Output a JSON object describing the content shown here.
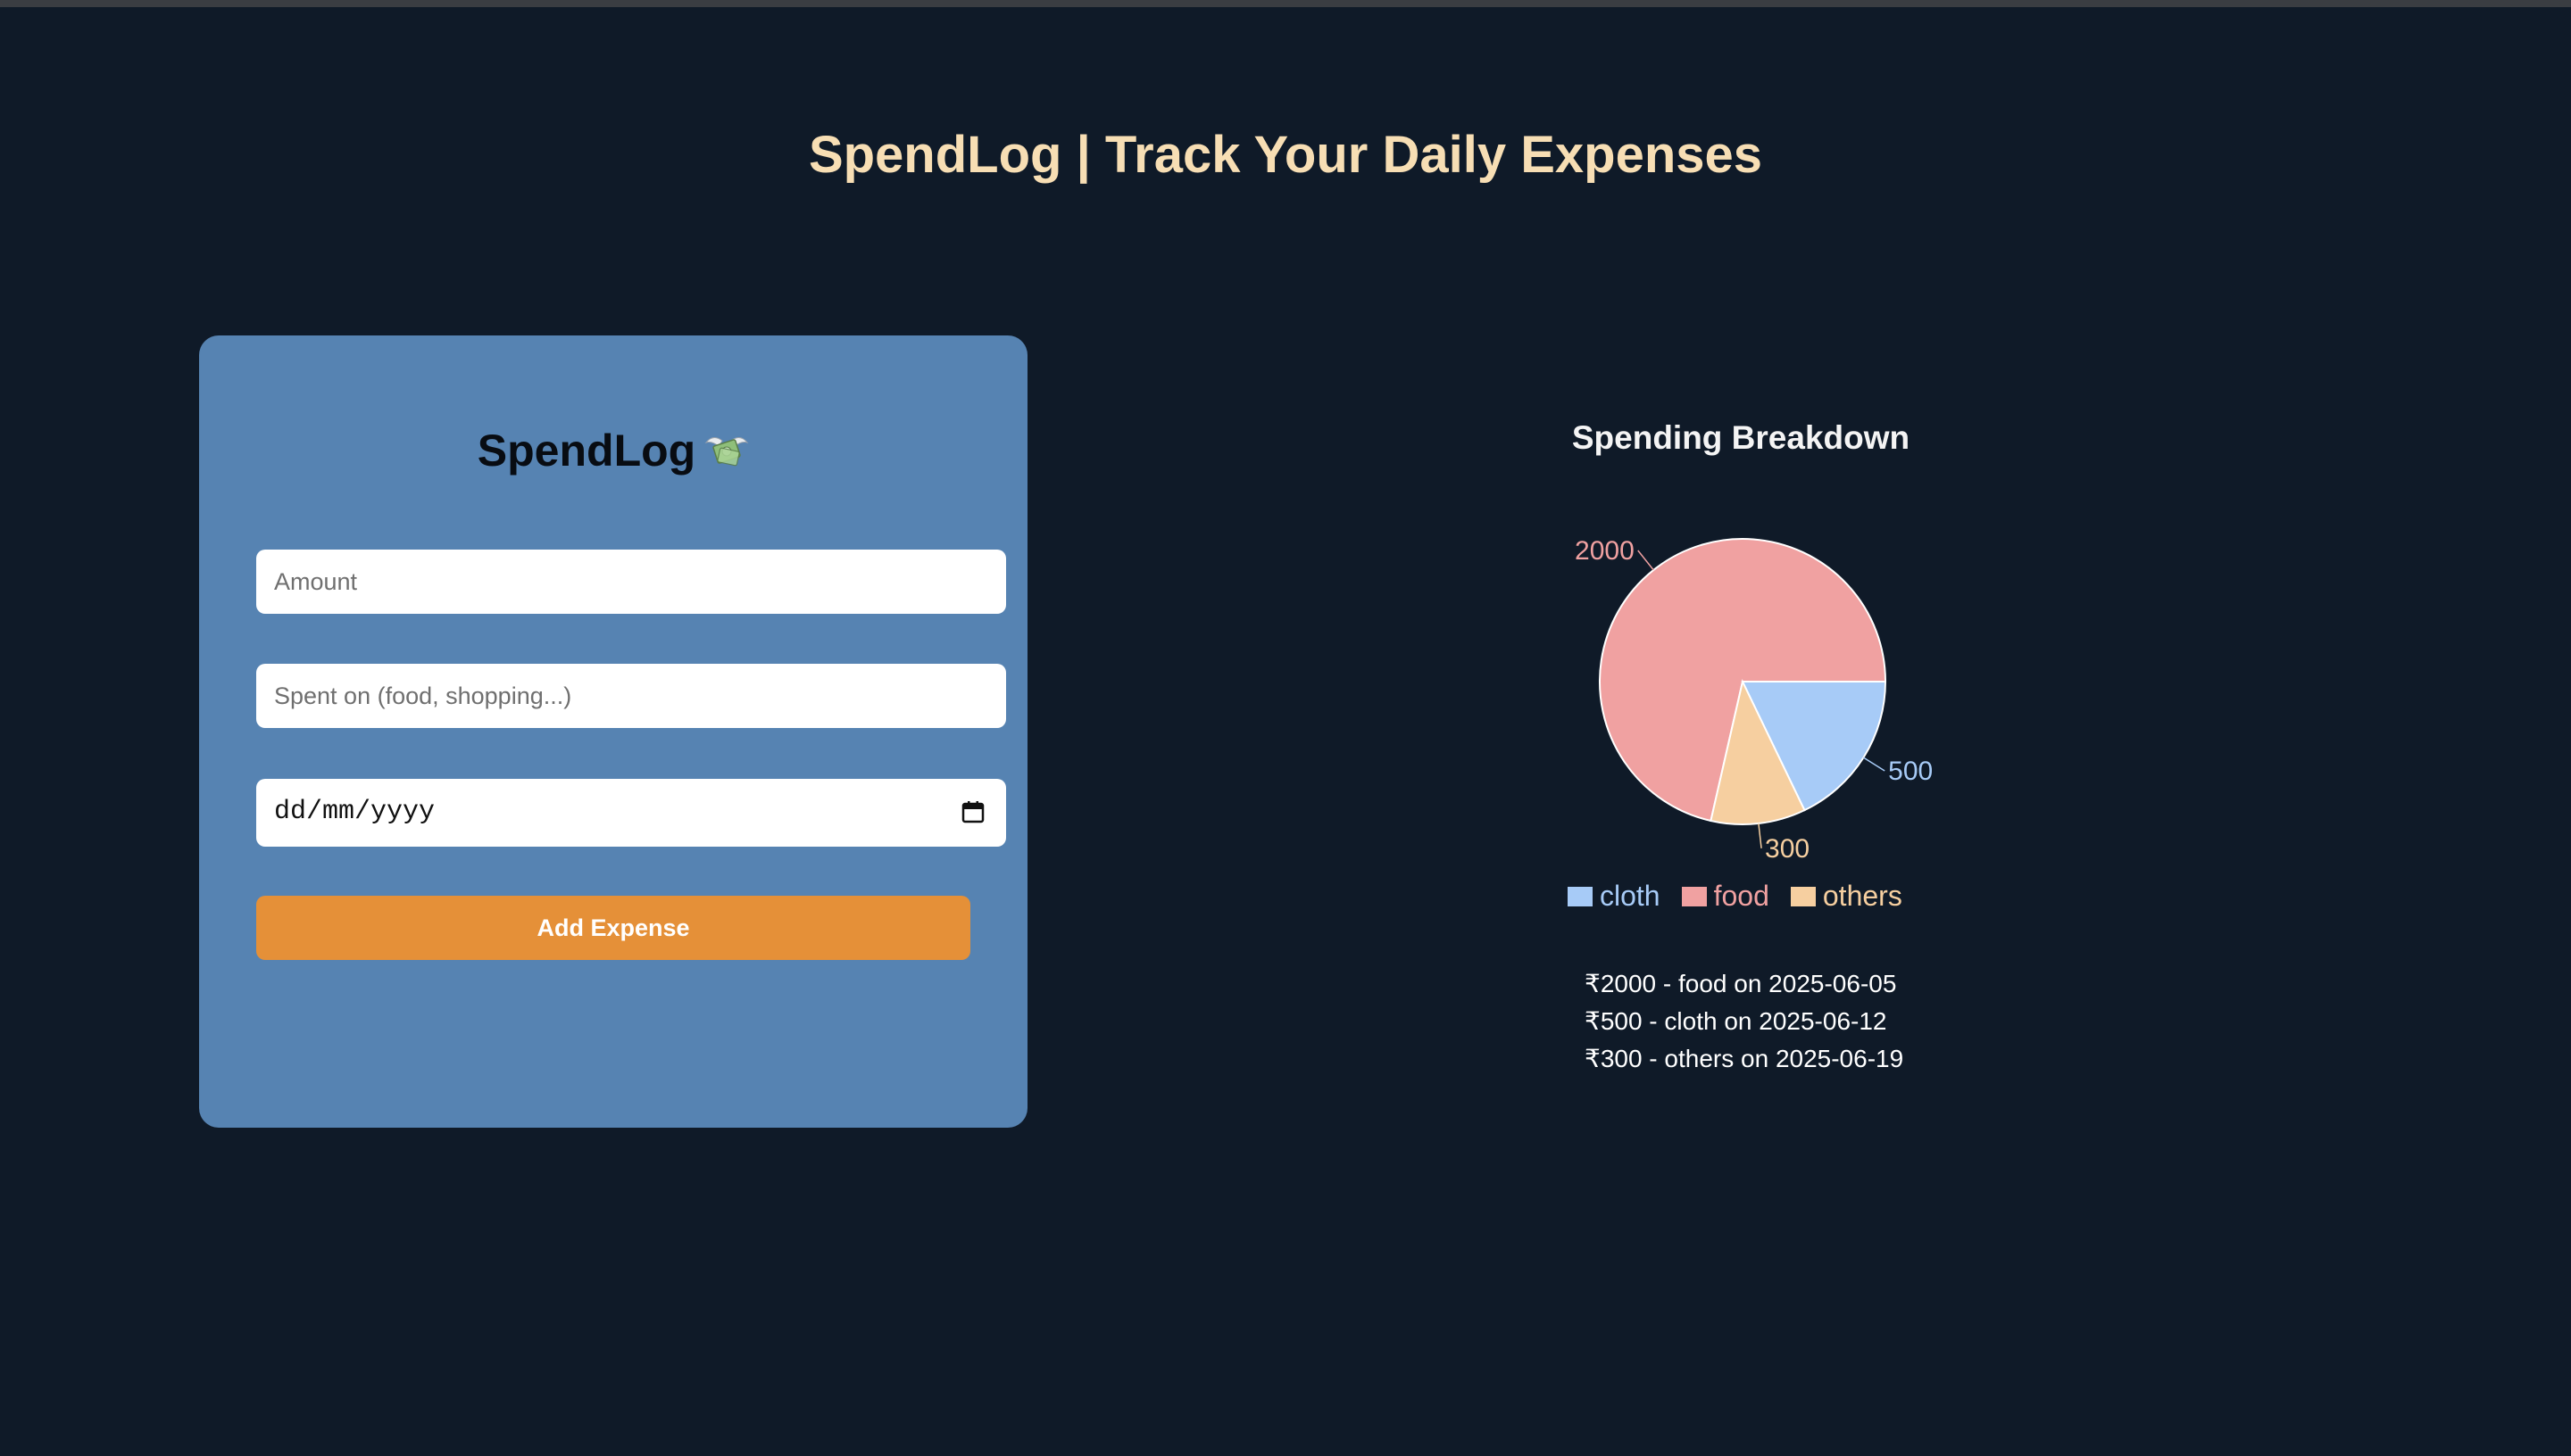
{
  "header": {
    "title": "SpendLog | Track Your Daily Expenses"
  },
  "form": {
    "title": "SpendLog",
    "title_icon": "money-with-wings-icon",
    "amount_placeholder": "Amount",
    "category_placeholder": "Spent on (food, shopping...)",
    "date_value": "dd/mm/yyyy",
    "date_icon": "calendar-icon",
    "submit_label": "Add Expense"
  },
  "chart": {
    "title": "Spending Breakdown",
    "legend": [
      {
        "label": "cloth",
        "color": "#a7cbf7"
      },
      {
        "label": "food",
        "color": "#f0a1a1"
      },
      {
        "label": "others",
        "color": "#f6cfa0"
      }
    ]
  },
  "chart_data": {
    "type": "pie",
    "title": "Spending Breakdown",
    "categories": [
      "food",
      "cloth",
      "others"
    ],
    "values": [
      2000,
      500,
      300
    ],
    "colors": [
      "#f0a1a1",
      "#a7cbf7",
      "#f6cfa0"
    ],
    "data_labels": [
      "2000",
      "500",
      "300"
    ],
    "legend_position": "bottom"
  },
  "expenses": [
    {
      "text": "₹2000 - food on 2025-06-05"
    },
    {
      "text": "₹500 - cloth on 2025-06-12"
    },
    {
      "text": "₹300 - others on 2025-06-19"
    }
  ],
  "colors": {
    "background": "#0f1a28",
    "card": "#5683b2",
    "accent": "#e59038",
    "title": "#f7deb4"
  }
}
